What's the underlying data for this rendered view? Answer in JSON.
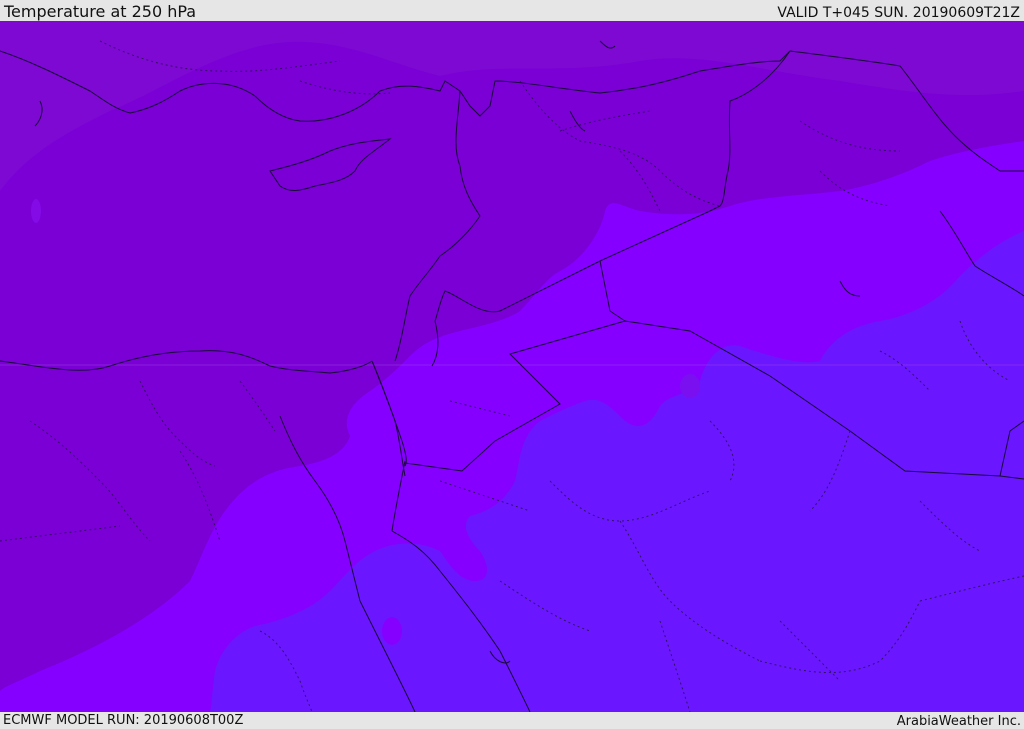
{
  "header": {
    "title": "Temperature at 250 hPa",
    "valid": "VALID T+045 SUN. 20190609T21Z"
  },
  "footer": {
    "model_run": "ECMWF MODEL RUN: 20190608T00Z",
    "credit": "ArabiaWeather Inc."
  },
  "map": {
    "field": "temperature-250hPa",
    "colors": {
      "dark_purple": "#7a00d6",
      "mid_purple": "#8500ff",
      "violet_blue": "#6a17ff",
      "band_top": "#7f10cf",
      "border_line": "#1a0a3a"
    }
  }
}
